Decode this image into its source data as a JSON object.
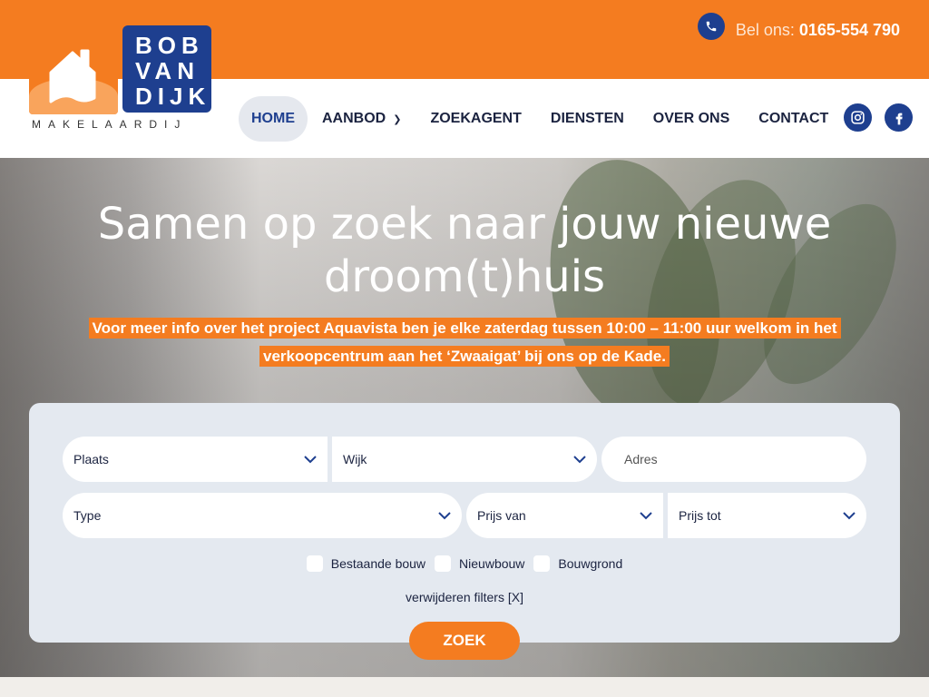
{
  "contact": {
    "label": "Bel ons:",
    "number": "0165-554 790"
  },
  "logo": {
    "line1": "BOB",
    "line2": "VAN",
    "line3": "DIJK",
    "sub": "MAKELAARDIJ"
  },
  "nav": {
    "home": "HOME",
    "aanbod": "AANBOD",
    "zoekagent": "ZOEKAGENT",
    "diensten": "DIENSTEN",
    "over": "OVER ONS",
    "contact": "CONTACT"
  },
  "hero": {
    "title_line1": "Samen op zoek naar jouw nieuwe",
    "title_line2": "droom(t)huis",
    "note": "Voor meer info over het project Aquavista ben je elke zaterdag tussen 10:00 – 11:00 uur welkom in het verkoopcentrum aan het ‘Zwaaigat’ bij ons op de Kade."
  },
  "search": {
    "plaats": "Plaats",
    "wijk": "Wijk",
    "adres_placeholder": "Adres",
    "type": "Type",
    "prijs_van": "Prijs van",
    "prijs_tot": "Prijs tot",
    "checks": [
      "Bestaande bouw",
      "Nieuwbouw",
      "Bouwgrond"
    ],
    "clear": "verwijderen filters [X]",
    "submit": "ZOEK"
  },
  "colors": {
    "accent": "#f47c20",
    "brand": "#1e3f8f"
  },
  "icons": [
    "phone-icon",
    "instagram-icon",
    "facebook-icon",
    "chevron-down-icon",
    "house-icon"
  ]
}
